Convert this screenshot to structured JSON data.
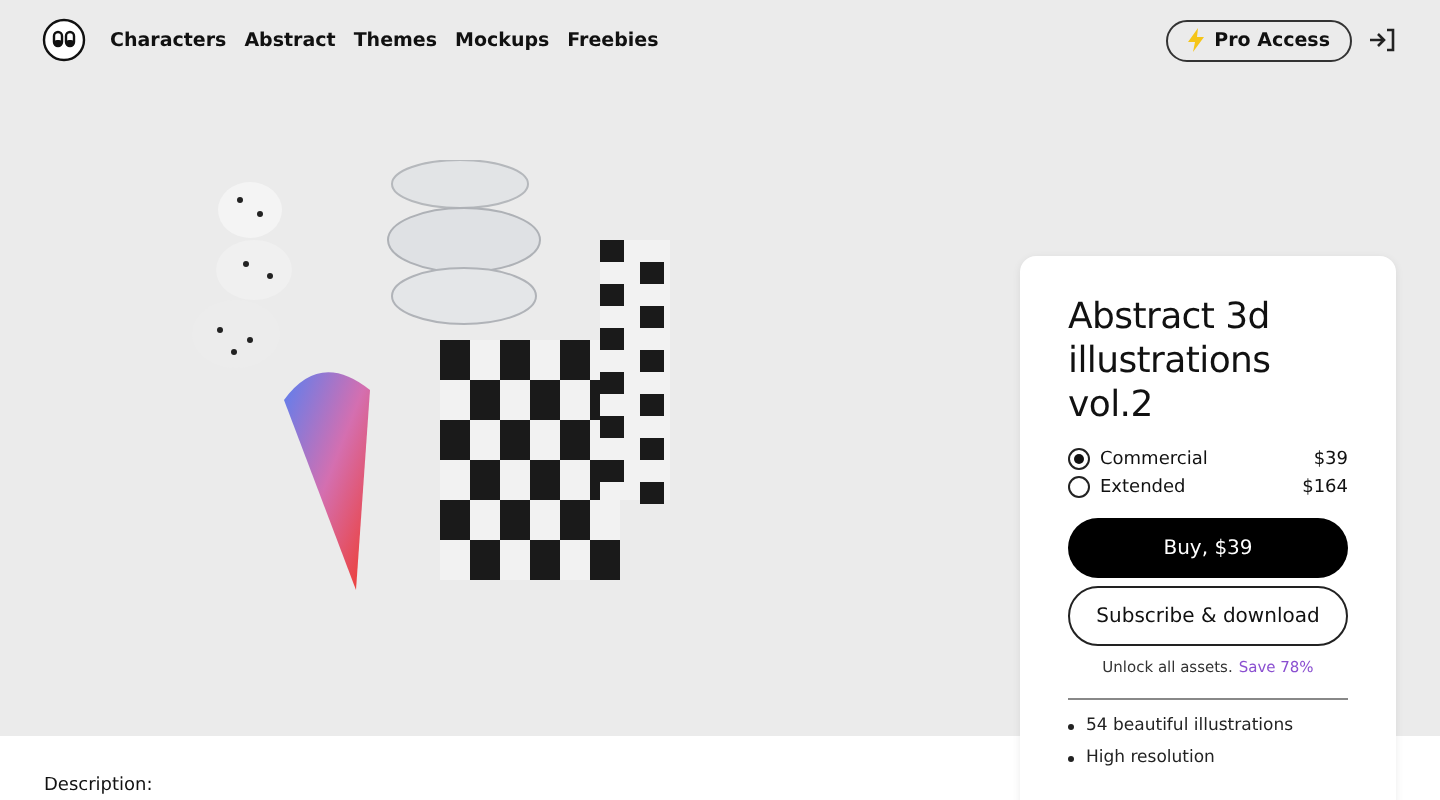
{
  "nav": {
    "links": [
      {
        "label": "Characters"
      },
      {
        "label": "Abstract"
      },
      {
        "label": "Themes"
      },
      {
        "label": "Mockups"
      },
      {
        "label": "Freebies"
      }
    ],
    "pro_button": "Pro Access"
  },
  "product": {
    "title": "Abstract 3d illustrations vol.2",
    "licenses": [
      {
        "name": "Commercial",
        "price": "$39",
        "selected": true
      },
      {
        "name": "Extended",
        "price": "$164",
        "selected": false
      }
    ],
    "buy_button": "Buy, $39",
    "subscribe_button": "Subscribe & download",
    "unlock_text": "Unlock all assets.",
    "save_link": "Save 78%",
    "features": [
      "54 beautiful illustrations",
      "High resolution"
    ]
  },
  "description_label": "Description:"
}
